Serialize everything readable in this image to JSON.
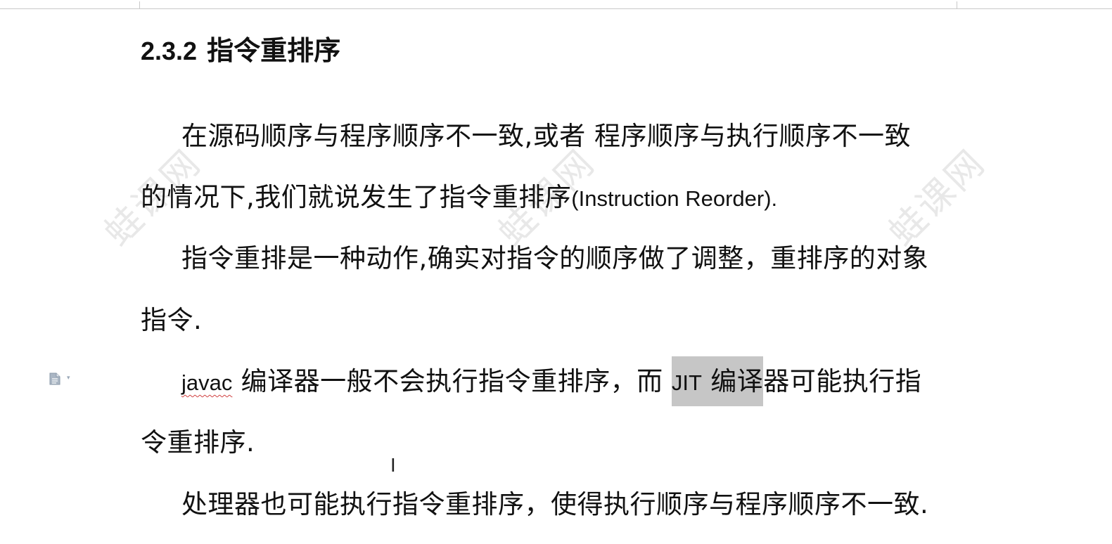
{
  "heading": {
    "number": "2.3.2",
    "title": "指令重排序"
  },
  "paragraphs": {
    "p1_line1": "在源码顺序与程序顺序不一致,或者  程序顺序与执行顺序不一致",
    "p1_line2_cn": "的情况下,我们就说发生了指令重排序",
    "p1_line2_en": "(Instruction Reorder).",
    "p2_line1": "指令重排是一种动作,确实对指令的顺序做了调整，重排序的对象",
    "p2_line2": "指令.",
    "p3_word_javac": "javac",
    "p3_mid": " 编译器一般不会执行指令重排序，而 ",
    "p3_selected_latin": "JIT",
    "p3_selected_cn": " 编译",
    "p3_rest": "器可能执行指",
    "p3_line2": "令重排序.",
    "p4_line1": "处理器也可能执行指令重排序，使得执行顺序与程序顺序不一致."
  },
  "watermark": {
    "text": "蛙课网"
  },
  "icons": {
    "side_icon": "document-icon",
    "side_caret": "chevron-down-icon",
    "cursor": "text-cursor-icon"
  },
  "colors": {
    "selection": "#c6c6c6",
    "spell_underline": "#d04040",
    "watermark": "#787878"
  }
}
